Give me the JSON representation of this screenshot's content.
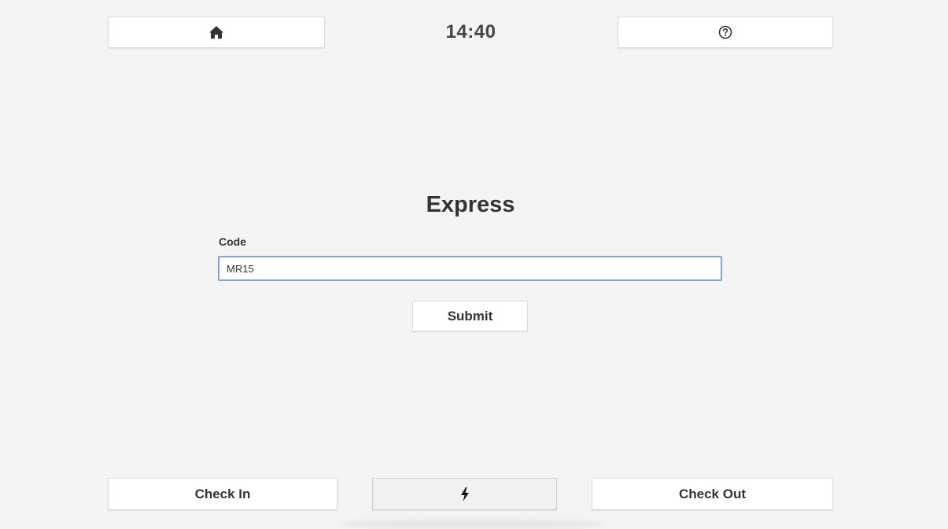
{
  "header": {
    "home_icon": "home-icon",
    "clock": "14:40",
    "help_icon": "question-circle-icon"
  },
  "main": {
    "title": "Express",
    "code_label": "Code",
    "code_value": "MR15",
    "submit_label": "Submit"
  },
  "footer": {
    "check_in_label": "Check In",
    "express_icon": "lightning-bolt-icon",
    "check_out_label": "Check Out"
  },
  "colors": {
    "background": "#f4f4f4",
    "button": "#ffffff",
    "input_focus_border": "#7aa7e3",
    "text": "#333333"
  }
}
